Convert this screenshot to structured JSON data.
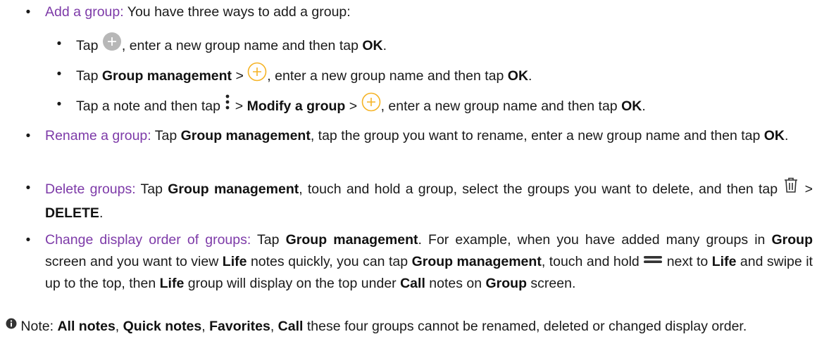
{
  "colors": {
    "topic": "#7d3aa8",
    "text": "#1a1a1a",
    "accent_circle": "#f5b325",
    "gray_circle": "#b7b7b7"
  },
  "items": [
    {
      "title": "Add a group:",
      "text": "You have three ways to add a group:",
      "sub": [
        {
          "p1": "Tap ",
          "icon": "gray-plus-circle-icon",
          "p2": ", enter a new group name and then tap ",
          "b1": "OK",
          "p3": "."
        },
        {
          "p1": "Tap ",
          "b1": "Group management",
          "p2": " > ",
          "icon": "yellow-plus-circle-icon",
          "p3": ", enter a new group name and then tap ",
          "b2": "OK",
          "p4": "."
        },
        {
          "p1": "Tap a note and then tap ",
          "icon": "more-vertical-icon",
          "p2": " > ",
          "b1": "Modify a group",
          "p3": " > ",
          "icon2": "yellow-plus-circle-icon",
          "p4": ", enter a new group name and then tap ",
          "b2": "OK",
          "p5": "."
        }
      ]
    },
    {
      "title": "Rename a group:",
      "p1": " Tap ",
      "b1": "Group management",
      "p2": ", tap the group you want to rename, enter a new group name and then tap ",
      "b2": "OK",
      "p3": "."
    },
    {
      "title": "Delete groups:",
      "p1": " Tap ",
      "b1": "Group management",
      "p2": ", touch and hold a group, select the groups you want to delete, and then tap ",
      "icon": "trash-icon",
      "p3": " > ",
      "b2": "DELETE",
      "p4": "."
    },
    {
      "title": "Change display order of groups:",
      "p1": " Tap ",
      "b1": "Group management",
      "p2": ". For example, when you have added many groups in ",
      "b2": "Group",
      "p3": " screen and you want to view ",
      "b3": "Life",
      "p4": " notes quickly, you can tap ",
      "b4": "Group management",
      "p5": ", touch and hold ",
      "icon": "drag-handle-icon",
      "p6": " next to ",
      "b5": "Life",
      "p7": " and swipe it up to the top, then ",
      "b6": "Life",
      "p8": " group will display on the top under ",
      "b7": "Call",
      "p9": " notes on ",
      "b8": "Group",
      "p10": " screen."
    }
  ],
  "note": {
    "icon": "info-icon",
    "label": "Note:",
    "b1": "All notes",
    "s1": ", ",
    "b2": "Quick notes",
    "s2": ", ",
    "b3": "Favorites",
    "s3": ", ",
    "b4": "Call",
    "text": " these four groups cannot be renamed, deleted or changed display order."
  }
}
